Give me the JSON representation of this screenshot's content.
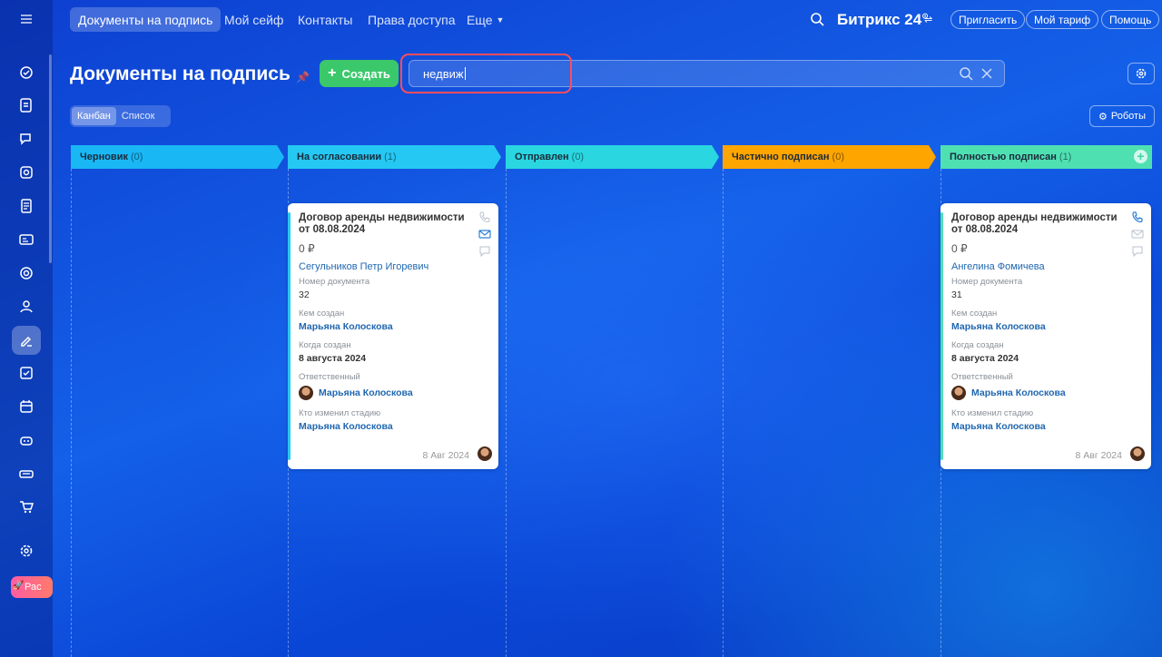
{
  "topbar": {
    "nav": [
      {
        "label": "Документы на подпись",
        "active": true
      },
      {
        "label": "Мой сейф"
      },
      {
        "label": "Контакты"
      },
      {
        "label": "Права доступа"
      },
      {
        "label": "Еще"
      }
    ],
    "brand": "Битрикс 24",
    "buttons": {
      "invite": "Пригласить",
      "tariff": "Мой тариф",
      "help": "Помощь"
    }
  },
  "sidebar": {
    "icons": [
      "ai-icon",
      "document-edit-icon",
      "chat-icon",
      "collab-icon",
      "form-icon",
      "card-icon",
      "target-icon",
      "people-icon",
      "signature-icon",
      "task-check-icon",
      "calendar-icon",
      "robot-icon",
      "printer-icon",
      "cart-icon",
      "settings-icon"
    ],
    "active_icon": "signature-icon",
    "promo_label": "Рас"
  },
  "page": {
    "title": "Документы на подпись",
    "create_label": "Создать",
    "search_value": "недвиж",
    "views": {
      "kanban": "Канбан",
      "list": "Список",
      "active": "kanban"
    },
    "robots_label": "Роботы"
  },
  "columns": [
    {
      "name": "Черновик",
      "count": "(0)",
      "color": "#1ab7f5"
    },
    {
      "name": "На согласовании",
      "count": "(1)",
      "color": "#25c8f3"
    },
    {
      "name": "Отправлен",
      "count": "(0)",
      "color": "#2ad6e0"
    },
    {
      "name": "Частично подписан",
      "count": "(0)",
      "color": "#ffa500"
    },
    {
      "name": "Полностью подписан",
      "count": "(1)",
      "color": "#4fe0b2"
    }
  ],
  "cards": [
    {
      "title": "Договор аренды недвижимости от 08.08.2024",
      "price": "0 ₽",
      "client": "Сегульников Петр Игоревич",
      "doc_number_label": "Номер документа",
      "doc_number": "32",
      "created_by_label": "Кем создан",
      "created_by": "Марьяна Колоскова",
      "created_when_label": "Когда создан",
      "created_when": "8 августа 2024",
      "responsible_label": "Ответственный",
      "responsible": "Марьяна Колоскова",
      "stage_changed_by_label": "Кто изменил стадию",
      "stage_changed_by": "Марьяна Колоскова",
      "date": "8 Авг 2024",
      "stripe_color": "#25c8f3"
    },
    {
      "title": "Договор аренды недвижимости от 08.08.2024",
      "price": "0 ₽",
      "client": "Ангелина Фомичева",
      "doc_number_label": "Номер документа",
      "doc_number": "31",
      "created_by_label": "Кем создан",
      "created_by": "Марьяна Колоскова",
      "created_when_label": "Когда создан",
      "created_when": "8 августа 2024",
      "responsible_label": "Ответственный",
      "responsible": "Марьяна Колоскова",
      "stage_changed_by_label": "Кто изменил стадию",
      "stage_changed_by": "Марьяна Колоскова",
      "date": "8 Авг 2024",
      "stripe_color": "#4fe0b2"
    }
  ]
}
